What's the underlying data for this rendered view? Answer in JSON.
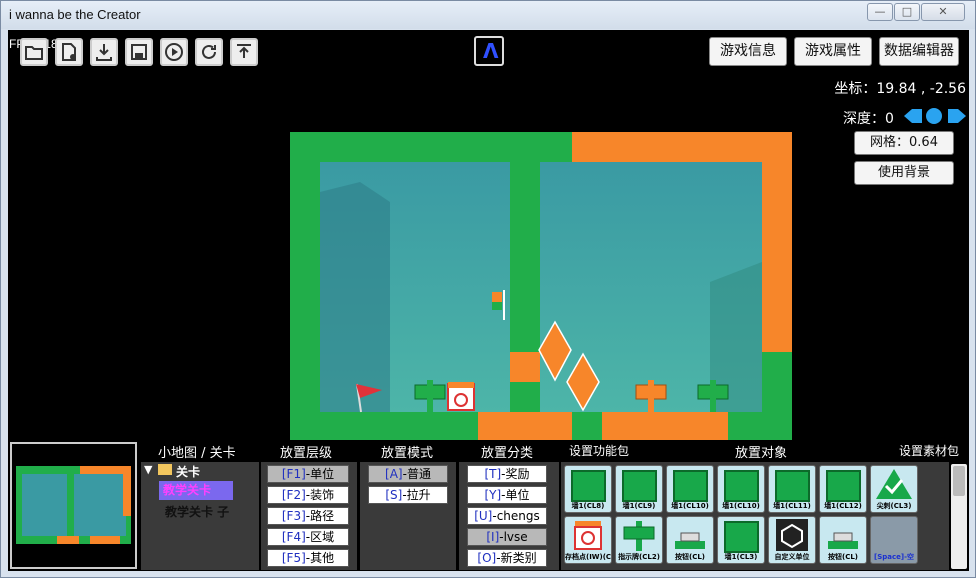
{
  "window": {
    "title": "i wanna be the Creator",
    "minimize": "—",
    "maximize": "□",
    "close": "✕"
  },
  "fps": "FPS：18",
  "toolbar": [
    {
      "name": "open-folder-icon"
    },
    {
      "name": "new-file-icon"
    },
    {
      "name": "download-icon"
    },
    {
      "name": "save-icon"
    },
    {
      "name": "play-icon"
    },
    {
      "name": "refresh-icon"
    },
    {
      "name": "upload-icon"
    }
  ],
  "center_icon": "Λ",
  "top_buttons": {
    "game_info": "游戏信息",
    "game_props": "游戏属性",
    "data_editor": "数据编辑器"
  },
  "coords": "坐标：19.84 , -2.56",
  "depth": "深度：0",
  "grid": "网格：0.64",
  "use_bg": "使用背景",
  "sections": {
    "minimap": "小地图 / 关卡",
    "layer": "放置层级",
    "mode": "放置模式",
    "category": "放置分类",
    "func_pack": "设置功能包",
    "object": "放置对象",
    "material_pack": "设置素材包"
  },
  "tree": {
    "root": "关卡",
    "item1": "教学关卡",
    "item2": "教学关卡 子"
  },
  "layers": [
    {
      "key": "[F1]",
      "label": "-单位"
    },
    {
      "key": "[F2]",
      "label": "-装饰"
    },
    {
      "key": "[F3]",
      "label": "-路径"
    },
    {
      "key": "[F4]",
      "label": "-区域"
    },
    {
      "key": "[F5]",
      "label": "-其他"
    }
  ],
  "modes": [
    {
      "key": "[A]",
      "label": "-普通"
    },
    {
      "key": "[S]",
      "label": "-拉升"
    }
  ],
  "categories": [
    {
      "key": "[T]",
      "label": "-奖励"
    },
    {
      "key": "[Y]",
      "label": "-单位"
    },
    {
      "key": "[U]",
      "label": "-chengs"
    },
    {
      "key": "[I]",
      "label": "-lvse"
    },
    {
      "key": "[O]",
      "label": "-新类别"
    }
  ],
  "objects_row1": [
    "墙1(CL8)",
    "墙1(CL9)",
    "墙1(CL10)",
    "墙1(CL10)",
    "墙1(CL11)",
    "墙1(CL12)",
    "尖刺(CL3)"
  ],
  "objects_row2": [
    "存档点(IW)(C",
    "指示牌(CL2)",
    "按钮(CL)",
    "墙1(CL3)",
    "自定义单位",
    "按钮(CL)",
    "[Space]-空"
  ],
  "colors": {
    "green": "#21ae4a",
    "orange": "#f7862a",
    "sky": "#3a9fa3"
  }
}
